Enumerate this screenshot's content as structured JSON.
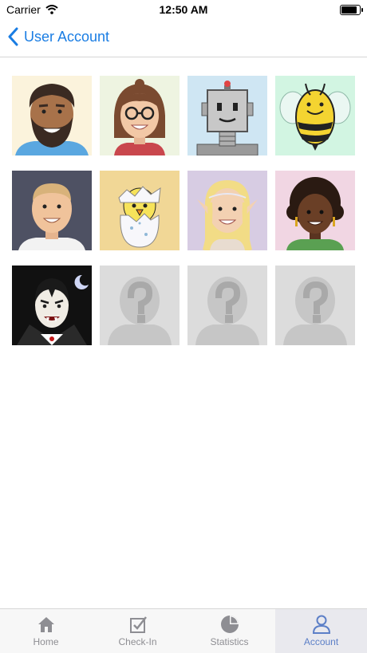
{
  "status_bar": {
    "carrier": "Carrier",
    "time": "12:50 AM",
    "battery_level": 0.95
  },
  "nav": {
    "back_label": "User Account"
  },
  "avatars": [
    {
      "icon": "bearded-man-avatar",
      "bg": "#fbf3dc"
    },
    {
      "icon": "woman-glasses-avatar",
      "bg": "#eef4e1"
    },
    {
      "icon": "robot-avatar",
      "bg": "#cfe6f3"
    },
    {
      "icon": "bee-avatar",
      "bg": "#d2f5e2"
    },
    {
      "icon": "buzzcut-man-avatar",
      "bg": "#4e5163"
    },
    {
      "icon": "hatching-chick-avatar",
      "bg": "#f1d796"
    },
    {
      "icon": "elf-avatar",
      "bg": "#d7cce3"
    },
    {
      "icon": "curly-hair-woman-avatar",
      "bg": "#f1d6e3"
    },
    {
      "icon": "vampire-avatar",
      "bg": "#111111"
    },
    {
      "icon": "locked-placeholder-avatar",
      "bg": "#dcdcdc"
    },
    {
      "icon": "locked-placeholder-avatar",
      "bg": "#dcdcdc"
    },
    {
      "icon": "locked-placeholder-avatar",
      "bg": "#dcdcdc"
    }
  ],
  "tabs": [
    {
      "label": "Home",
      "icon": "home-icon",
      "active": false
    },
    {
      "label": "Check-In",
      "icon": "checkbox-icon",
      "active": false
    },
    {
      "label": "Statistics",
      "icon": "pie-chart-icon",
      "active": false
    },
    {
      "label": "Account",
      "icon": "person-icon",
      "active": true
    }
  ],
  "colors": {
    "accent": "#1a7de3",
    "tab_active": "#5c7fc7",
    "tab_inactive": "#8e8e93"
  }
}
